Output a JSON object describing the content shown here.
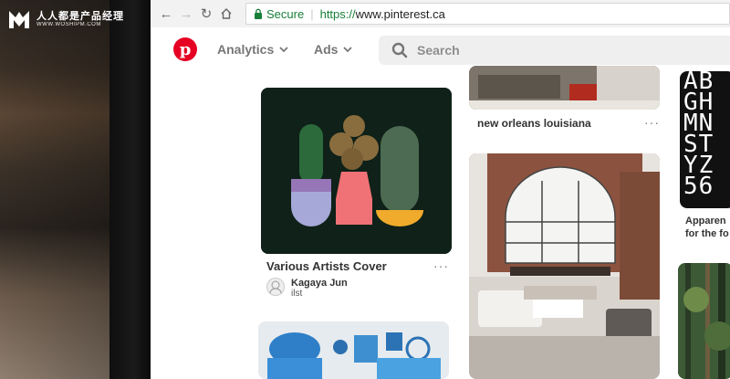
{
  "watermark": {
    "cn": "人人都是产品经理",
    "en": "WWW.WOSHIPM.COM"
  },
  "browser": {
    "secure_label": "Secure",
    "url_protocol": "https://",
    "url_host": "www.pinterest.ca"
  },
  "pinterest": {
    "logo_letter": "p",
    "menu": [
      {
        "label": "Analytics"
      },
      {
        "label": "Ads"
      }
    ],
    "search_placeholder": "Search"
  },
  "pins": {
    "top": {
      "title": "new orleans louisiana",
      "more": "···"
    },
    "cactus": {
      "title": "Various Artists Cover",
      "more": "···",
      "author": "Kagaya Jun",
      "board": "ilst"
    },
    "typography": {
      "letters": [
        "AB",
        "GH",
        "MN",
        "ST",
        "YZ",
        "56"
      ],
      "title_line1": "Apparen",
      "title_line2": "for the fo"
    }
  },
  "colors": {
    "brand": "#e60023",
    "secure": "#188038"
  }
}
